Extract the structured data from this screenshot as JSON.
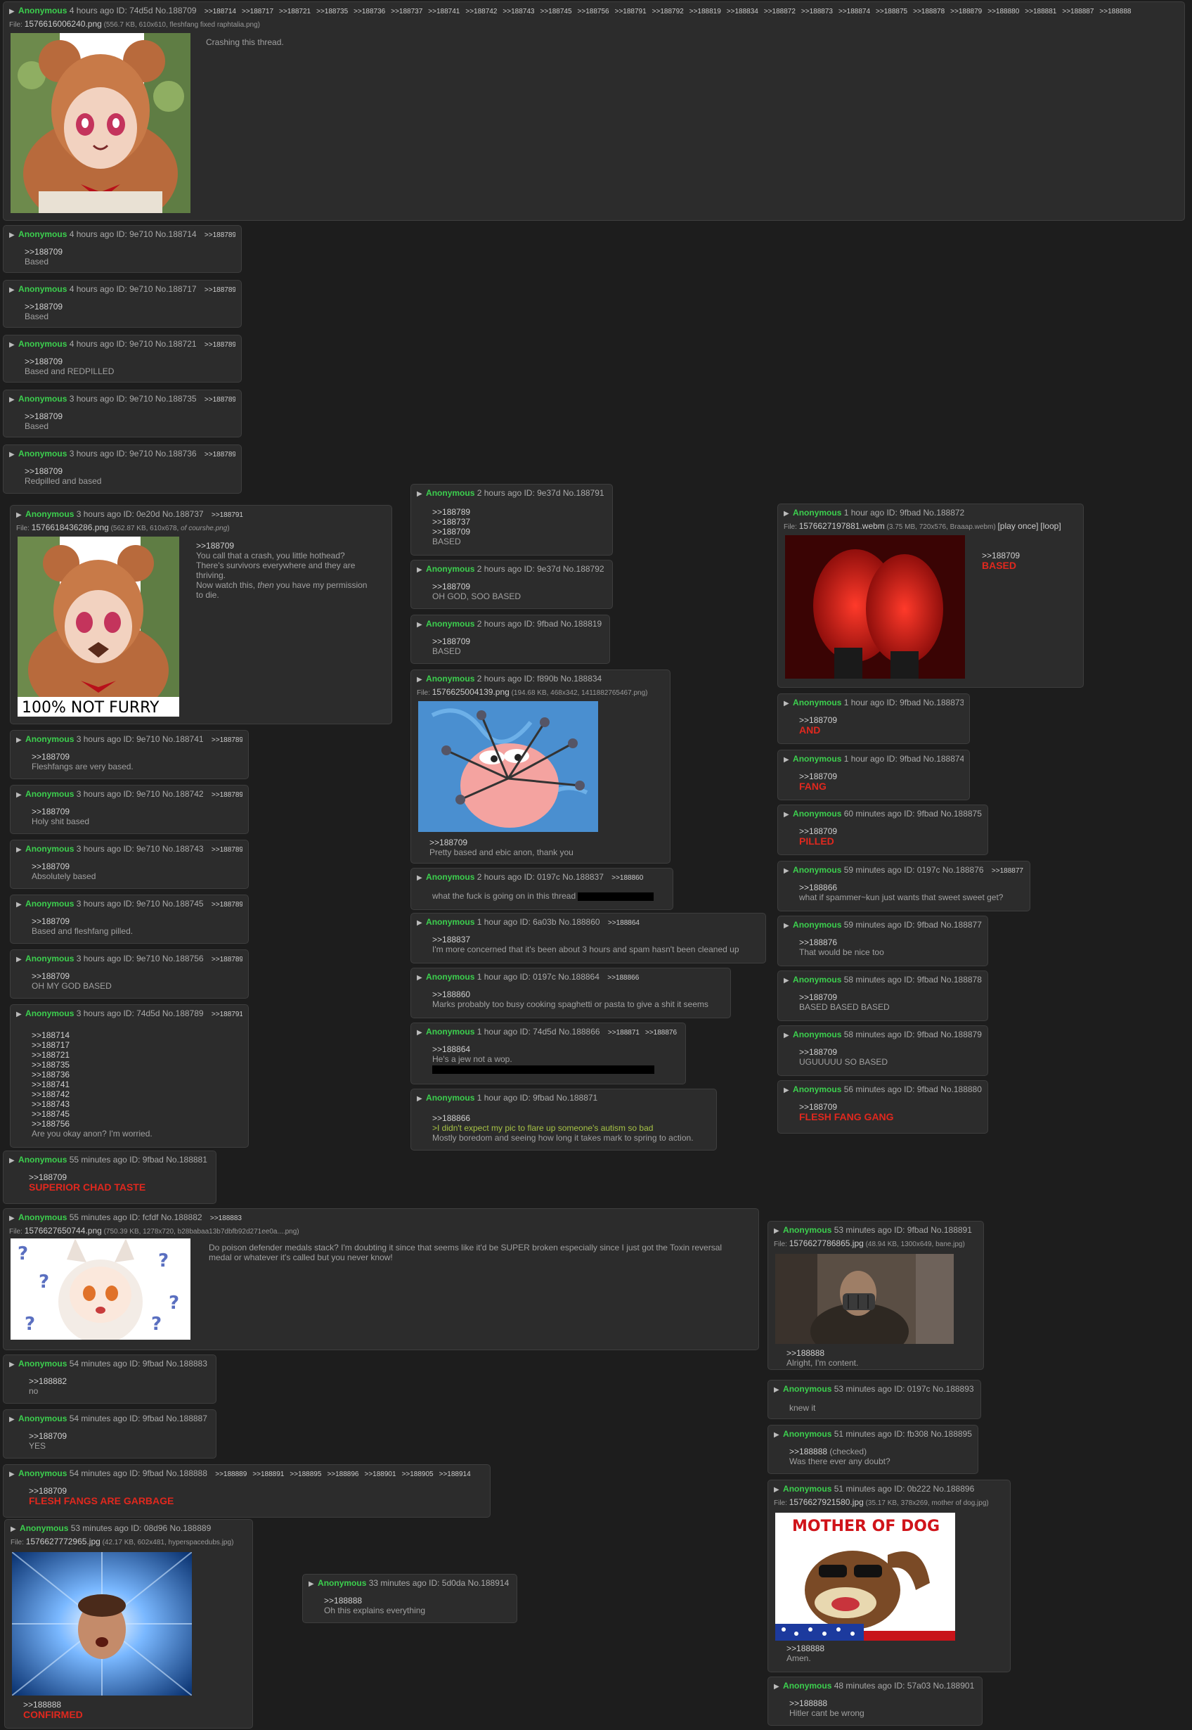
{
  "op": {
    "name": "Anonymous",
    "time": "4 hours ago",
    "id": "ID: 74d5d",
    "no": "No.188709",
    "replies": [
      ">>188714",
      ">>188717",
      ">>188721",
      ">>188735",
      ">>188736",
      ">>188737",
      ">>188741",
      ">>188742",
      ">>188743",
      ">>188745",
      ">>188756",
      ">>188791",
      ">>188792",
      ">>188819",
      ">>188834",
      ">>188872",
      ">>188873",
      ">>188874",
      ">>188875",
      ">>188878",
      ">>188879",
      ">>188880",
      ">>188881",
      ">>188887",
      ">>188888"
    ],
    "file_label": "File:",
    "file_name": "1576616006240.png",
    "file_meta": "(556.7 KB, 610x610, fleshfang fixed raphtalia.png)",
    "text": "Crashing this thread."
  },
  "p188714": {
    "time": "4 hours ago",
    "id": "ID: 9e710",
    "no": "No.188714",
    "reply": ">>188789",
    "quote": ">>188709",
    "text": "Based"
  },
  "p188717": {
    "time": "4 hours ago",
    "id": "ID: 9e710",
    "no": "No.188717",
    "reply": ">>188789",
    "quote": ">>188709",
    "text": "Based"
  },
  "p188721": {
    "time": "4 hours ago",
    "id": "ID: 9e710",
    "no": "No.188721",
    "reply": ">>188789",
    "quote": ">>188709",
    "text": "Based and REDPILLED"
  },
  "p188735": {
    "time": "3 hours ago",
    "id": "ID: 9e710",
    "no": "No.188735",
    "reply": ">>188789",
    "quote": ">>188709",
    "text": "Based"
  },
  "p188736": {
    "time": "3 hours ago",
    "id": "ID: 9e710",
    "no": "No.188736",
    "reply": ">>188789",
    "quote": ">>188709",
    "text": "Redpilled and based"
  },
  "p188737": {
    "time": "3 hours ago",
    "id": "ID: 0e20d",
    "no": "No.188737",
    "reply": ">>188791",
    "file_label": "File:",
    "file_name": "1576618436286.png",
    "file_meta": "(562.87 KB, 610x678, ",
    "file_orig": "of courshe.png",
    "file_close": ")",
    "quote": ">>188709",
    "l1": "You call that a crash, you little hothead?",
    "l2": "There's survivors everywhere and they are",
    "l3": "thriving.",
    "l4a": "Now watch this, ",
    "l4b": "then",
    "l4c": " you have my permission",
    "l5": "to die.",
    "img_caption": "100% NOT FURRY"
  },
  "p188741": {
    "time": "3 hours ago",
    "id": "ID: 9e710",
    "no": "No.188741",
    "reply": ">>188789",
    "quote": ">>188709",
    "text": "Fleshfangs are very based."
  },
  "p188742": {
    "time": "3 hours ago",
    "id": "ID: 9e710",
    "no": "No.188742",
    "reply": ">>188789",
    "quote": ">>188709",
    "text": "Holy shit based"
  },
  "p188743": {
    "time": "3 hours ago",
    "id": "ID: 9e710",
    "no": "No.188743",
    "reply": ">>188789",
    "quote": ">>188709",
    "text": "Absolutely based"
  },
  "p188745": {
    "time": "3 hours ago",
    "id": "ID: 9e710",
    "no": "No.188745",
    "reply": ">>188789",
    "quote": ">>188709",
    "text": "Based and fleshfang pilled."
  },
  "p188756": {
    "time": "3 hours ago",
    "id": "ID: 9e710",
    "no": "No.188756",
    "reply": ">>188789",
    "quote": ">>188709",
    "text": "OH MY GOD BASED"
  },
  "p188789": {
    "time": "3 hours ago",
    "id": "ID: 74d5d",
    "no": "No.188789",
    "reply": ">>188791",
    "quotes": [
      ">>188714",
      ">>188717",
      ">>188721",
      ">>188735",
      ">>188736",
      ">>188741",
      ">>188742",
      ">>188743",
      ">>188745",
      ">>188756"
    ],
    "text": "Are you okay anon? I'm worried."
  },
  "p188791": {
    "time": "2 hours ago",
    "id": "ID: 9e37d",
    "no": "No.188791",
    "quotes": [
      ">>188789",
      ">>188737",
      ">>188709"
    ],
    "text": "BASED"
  },
  "p188792": {
    "time": "2 hours ago",
    "id": "ID: 9e37d",
    "no": "No.188792",
    "quote": ">>188709",
    "text": "OH GOD, SOO BASED"
  },
  "p188819": {
    "time": "2 hours ago",
    "id": "ID: 9fbad",
    "no": "No.188819",
    "quote": ">>188709",
    "text": "BASED"
  },
  "p188834": {
    "time": "2 hours ago",
    "id": "ID: f890b",
    "no": "No.188834",
    "file_label": "File:",
    "file_name": "1576625004139.png",
    "file_meta": "(194.68 KB, 468x342, ",
    "file_orig": "1411882765467.png",
    "file_close": ")",
    "quote": ">>188709",
    "text": "Pretty based and ebic anon, thank you"
  },
  "p188837": {
    "time": "2 hours ago",
    "id": "ID: 0197c",
    "no": "No.188837",
    "reply": ">>188860",
    "text": "what the fuck is going on in this thread"
  },
  "p188860": {
    "time": "1 hour ago",
    "id": "ID: 6a03b",
    "no": "No.188860",
    "reply": ">>188864",
    "quote": ">>188837",
    "text": "I'm more concerned that it's been about 3 hours and spam hasn't been cleaned up"
  },
  "p188864": {
    "time": "1 hour ago",
    "id": "ID: 0197c",
    "no": "No.188864",
    "reply": ">>188866",
    "quote": ">>188860",
    "text": "Marks probably too busy cooking spaghetti or pasta to give a shit it seems"
  },
  "p188866": {
    "time": "1 hour ago",
    "id": "ID: 74d5d",
    "no": "No.188866",
    "reply1": ">>188871",
    "reply2": ">>188876",
    "quote": ">>188864",
    "text": "He's a jew not a wop."
  },
  "p188871": {
    "time": "1 hour ago",
    "id": "ID: 9fbad",
    "no": "No.188871",
    "quote": ">>188866",
    "greentext": ">I didn't expect my pic to flare up someone's autism so bad",
    "text": "Mostly boredom and seeing how long it takes mark to spring to action."
  },
  "p188872": {
    "time": "1 hour ago",
    "id": "ID: 9fbad",
    "no": "No.188872",
    "file_label": "File:",
    "file_name": "1576627197881.webm",
    "file_meta": "(3.75 MB, 720x576, ",
    "file_orig": "Braaap.webm",
    "file_close": ")",
    "play_once": "[play once]",
    "loop": "[loop]",
    "quote": ">>188709",
    "text": "BASED"
  },
  "p188873": {
    "time": "1 hour ago",
    "id": "ID: 9fbad",
    "no": "No.188873",
    "quote": ">>188709",
    "text": "AND"
  },
  "p188874": {
    "time": "1 hour ago",
    "id": "ID: 9fbad",
    "no": "No.188874",
    "quote": ">>188709",
    "text": "FANG"
  },
  "p188875": {
    "time": "60 minutes ago",
    "id": "ID: 9fbad",
    "no": "No.188875",
    "quote": ">>188709",
    "text": "PILLED"
  },
  "p188876": {
    "time": "59 minutes ago",
    "id": "ID: 0197c",
    "no": "No.188876",
    "reply": ">>188877",
    "quote": ">>188866",
    "text": "what if spammer~kun just wants that sweet sweet get?"
  },
  "p188877": {
    "time": "59 minutes ago",
    "id": "ID: 9fbad",
    "no": "No.188877",
    "quote": ">>188876",
    "text": "That would be nice too"
  },
  "p188878": {
    "time": "58 minutes ago",
    "id": "ID: 9fbad",
    "no": "No.188878",
    "quote": ">>188709",
    "text": "BASED BASED BASED"
  },
  "p188879": {
    "time": "58 minutes ago",
    "id": "ID: 9fbad",
    "no": "No.188879",
    "quote": ">>188709",
    "text": "UGUUUUU SO BASED"
  },
  "p188880": {
    "time": "56 minutes ago",
    "id": "ID: 9fbad",
    "no": "No.188880",
    "quote": ">>188709",
    "text": "FLESH FANG GANG"
  },
  "p188881": {
    "time": "55 minutes ago",
    "id": "ID: 9fbad",
    "no": "No.188881",
    "quote": ">>188709",
    "text": "SUPERIOR CHAD TASTE"
  },
  "p188882": {
    "time": "55 minutes ago",
    "id": "ID: fcfdf",
    "no": "No.188882",
    "reply": ">>188883",
    "file_label": "File:",
    "file_name": "1576627650744.png",
    "file_meta": "(750.39 KB, 1278x720, ",
    "file_orig": "b28babaa13b7dbfb92d271ee0a....png",
    "file_close": ")",
    "text1": "Do poison defender medals stack? I'm doubting it since that seems like it'd be SUPER broken especially since I just got the Toxin reversal",
    "text2": "medal or whatever it's called but you never know!"
  },
  "p188883": {
    "time": "54 minutes ago",
    "id": "ID: 9fbad",
    "no": "No.188883",
    "quote": ">>188882",
    "text": "no"
  },
  "p188887": {
    "time": "54 minutes ago",
    "id": "ID: 9fbad",
    "no": "No.188887",
    "quote": ">>188709",
    "text": "YES"
  },
  "p188888": {
    "time": "54 minutes ago",
    "id": "ID: 9fbad",
    "no": "No.188888",
    "replies": [
      ">>188889",
      ">>188891",
      ">>188895",
      ">>188896",
      ">>188901",
      ">>188905",
      ">>188914"
    ],
    "quote": ">>188709",
    "text": "FLESH FANGS ARE GARBAGE"
  },
  "p188889": {
    "time": "53 minutes ago",
    "id": "ID: 08d96",
    "no": "No.188889",
    "file_label": "File:",
    "file_name": "1576627772965.jpg",
    "file_meta": "(42.17 KB, 602x481, ",
    "file_orig": "hyperspacedubs.jpg",
    "file_close": ")",
    "quote": ">>188888",
    "text": "CONFIRMED"
  },
  "p188914": {
    "time": "33 minutes ago",
    "id": "ID: 5d0da",
    "no": "No.188914",
    "quote": ">>188888",
    "text": "Oh this explains everything"
  },
  "p188891": {
    "time": "53 minutes ago",
    "id": "ID: 9fbad",
    "no": "No.188891",
    "file_label": "File:",
    "file_name": "1576627786865.jpg",
    "file_meta": "(48.94 KB, 1300x649, ",
    "file_orig": "bane.jpg",
    "file_close": ")",
    "quote": ">>188888",
    "text": "Alright, I'm content."
  },
  "p188893": {
    "time": "53 minutes ago",
    "id": "ID: 0197c",
    "no": "No.188893",
    "text": "knew it"
  },
  "p188895": {
    "time": "51 minutes ago",
    "id": "ID: fb308",
    "no": "No.188895",
    "quote": ">>188888",
    "checked": "(checked)",
    "text": "Was there ever any doubt?"
  },
  "p188896": {
    "time": "51 minutes ago",
    "id": "ID: 0b222",
    "no": "No.188896",
    "file_label": "File:",
    "file_name": "1576627921580.jpg",
    "file_meta": "(35.17 KB, 378x269, ",
    "file_orig": "mother of dog.jpg",
    "file_close": ")",
    "img_caption": "MOTHER OF DOG",
    "quote": ">>188888",
    "text": "Amen."
  },
  "p188901": {
    "time": "48 minutes ago",
    "id": "ID: 57a03",
    "no": "No.188901",
    "quote": ">>188888",
    "text": "Hitler cant be wrong"
  },
  "author": "Anonymous",
  "colors": {
    "name": "#3ccf4e",
    "red": "#e0281e",
    "greentext": "#a6c246",
    "bg": "#1d1d1d",
    "post": "#2c2c2c"
  }
}
